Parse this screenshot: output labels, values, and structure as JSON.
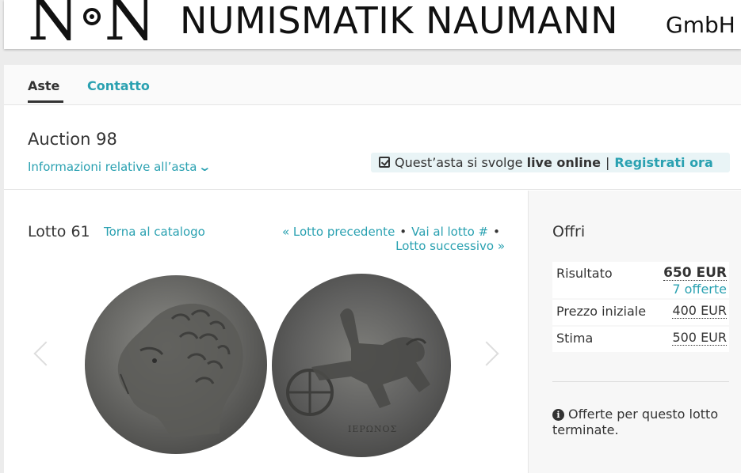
{
  "header": {
    "logo_mark_left": "N",
    "logo_mark_right": "N",
    "logo_title": "NUMISMATIK NAUMANN",
    "logo_suffix": "GmbH"
  },
  "tabs": [
    {
      "label": "Aste",
      "active": true
    },
    {
      "label": "Contatto",
      "active": false
    }
  ],
  "auction": {
    "title": "Auction 98",
    "info_link": "Informazioni relative all’asta",
    "info_icon": "chevron-down-icon",
    "live_prefix": "Quest’asta si svolge",
    "live_bold": "live online",
    "live_separator": "|",
    "register_link": "Registrati ora"
  },
  "lot": {
    "label": "Lotto 61",
    "back_link": "Torna al catalogo",
    "prev_link": "« Lotto precedente",
    "goto_link": "Vai al lotto #",
    "next_link": "Lotto successivo »",
    "bullet": "•",
    "image_inscription": "ΙΕΡΩΝΟΣ"
  },
  "bid": {
    "heading": "Offri",
    "result_label": "Risultato",
    "result_value": "650 EUR",
    "offers_link": "7 offerte",
    "start_label": "Prezzo iniziale",
    "start_value": "400 EUR",
    "estimate_label": "Stima",
    "estimate_value": "500 EUR",
    "closed_message": "Offerte per questo lotto terminate.",
    "closed_icon": "info-icon"
  },
  "colors": {
    "accent": "#2aa1b1",
    "text": "#333333",
    "background": "#ececec",
    "live_box": "#e9f4f6"
  }
}
